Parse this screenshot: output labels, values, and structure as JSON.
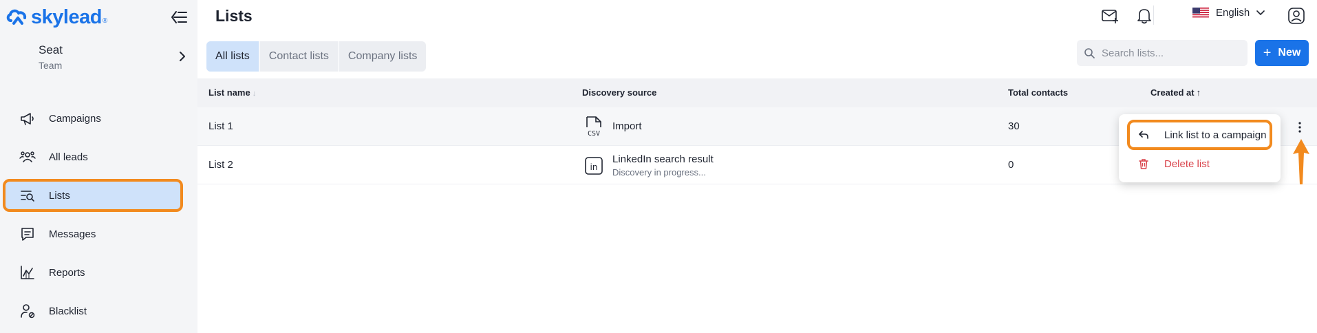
{
  "brand": {
    "name": "skylead",
    "reg": "®"
  },
  "seat": {
    "name": "Seat",
    "team": "Team"
  },
  "nav": {
    "campaigns": "Campaigns",
    "all_leads": "All leads",
    "lists": "Lists",
    "messages": "Messages",
    "reports": "Reports",
    "blacklist": "Blacklist"
  },
  "header": {
    "title": "Lists",
    "language": "English"
  },
  "tabs": {
    "all": "All lists",
    "contact": "Contact lists",
    "company": "Company lists"
  },
  "search": {
    "placeholder": "Search lists..."
  },
  "new_button": {
    "label": "New",
    "plus": "+"
  },
  "table": {
    "columns": {
      "name": "List name",
      "source": "Discovery source",
      "contacts": "Total contacts",
      "created": "Created at"
    },
    "sort": {
      "name_arrow": "↓",
      "created_arrow": "↑"
    },
    "rows": [
      {
        "name": "List 1",
        "source": "Import",
        "source_icon_text": "CSV",
        "contacts": "30"
      },
      {
        "name": "List 2",
        "source": "LinkedIn search result",
        "source_sub": "Discovery in progress...",
        "source_icon_text": "in",
        "contacts": "0"
      }
    ]
  },
  "menu": {
    "link": "Link list to a campaign",
    "delete": "Delete list"
  },
  "colors": {
    "accent": "#1a73e8",
    "highlight": "#f28a1e",
    "danger": "#d9434b",
    "active_bg": "#cfe2fa"
  }
}
